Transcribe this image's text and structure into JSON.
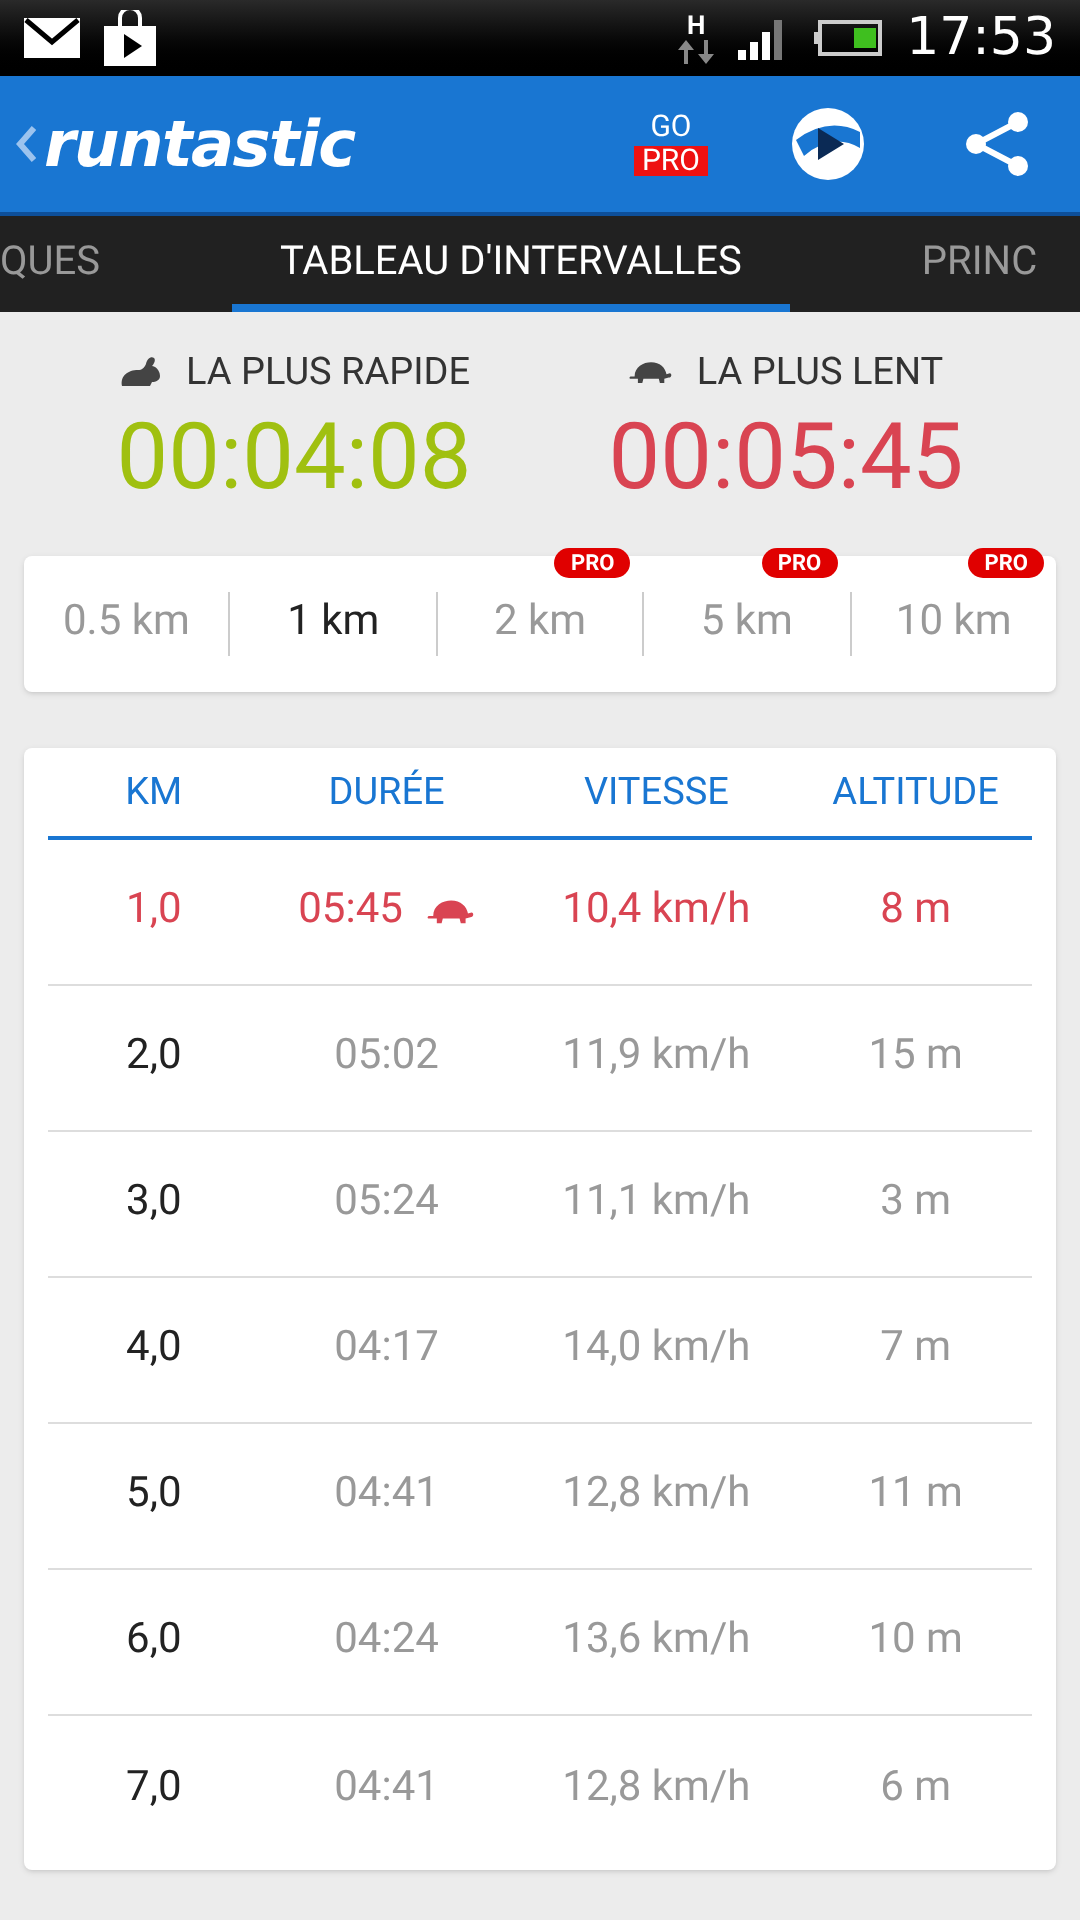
{
  "status_bar": {
    "network": "H",
    "time": "17:53"
  },
  "app_bar": {
    "logo": "runtastic",
    "go_pro": {
      "top": "GO",
      "badge": "PRO"
    }
  },
  "tabs": [
    {
      "label": "QUES",
      "selected": false
    },
    {
      "label": "TABLEAU D'INTERVALLES",
      "selected": true
    },
    {
      "label": "PRINC",
      "selected": false
    }
  ],
  "summary": [
    {
      "kind": "fastest",
      "label": "LA PLUS RAPIDE",
      "time": "00:04:08"
    },
    {
      "kind": "slowest",
      "label": "LA PLUS LENT",
      "time": "00:05:45"
    }
  ],
  "intervals": [
    {
      "label": "0.5 km",
      "selected": false
    },
    {
      "label": "1 km",
      "selected": true
    },
    {
      "label": "2 km",
      "selected": false,
      "badge": "PRO"
    },
    {
      "label": "5 km",
      "selected": false,
      "badge": "PRO"
    },
    {
      "label": "10 km",
      "selected": false,
      "badge": "PRO"
    }
  ],
  "table": {
    "columns": [
      "KM",
      "DURÉE",
      "VITESSE",
      "ALTITUDE"
    ],
    "rows": [
      {
        "km": "1,0",
        "duration": "05:45",
        "speed": "10,4 km/h",
        "altitude": "8 m",
        "slowest": true
      },
      {
        "km": "2,0",
        "duration": "05:02",
        "speed": "11,9 km/h",
        "altitude": "15 m",
        "slowest": false
      },
      {
        "km": "3,0",
        "duration": "05:24",
        "speed": "11,1 km/h",
        "altitude": "3 m",
        "slowest": false
      },
      {
        "km": "4,0",
        "duration": "04:17",
        "speed": "14,0 km/h",
        "altitude": "7 m",
        "slowest": false
      },
      {
        "km": "5,0",
        "duration": "04:41",
        "speed": "12,8 km/h",
        "altitude": "11 m",
        "slowest": false
      },
      {
        "km": "6,0",
        "duration": "04:24",
        "speed": "13,6 km/h",
        "altitude": "10 m",
        "slowest": false
      },
      {
        "km": "7,0",
        "duration": "04:41",
        "speed": "12,8 km/h",
        "altitude": "6 m",
        "slowest": false
      }
    ]
  }
}
